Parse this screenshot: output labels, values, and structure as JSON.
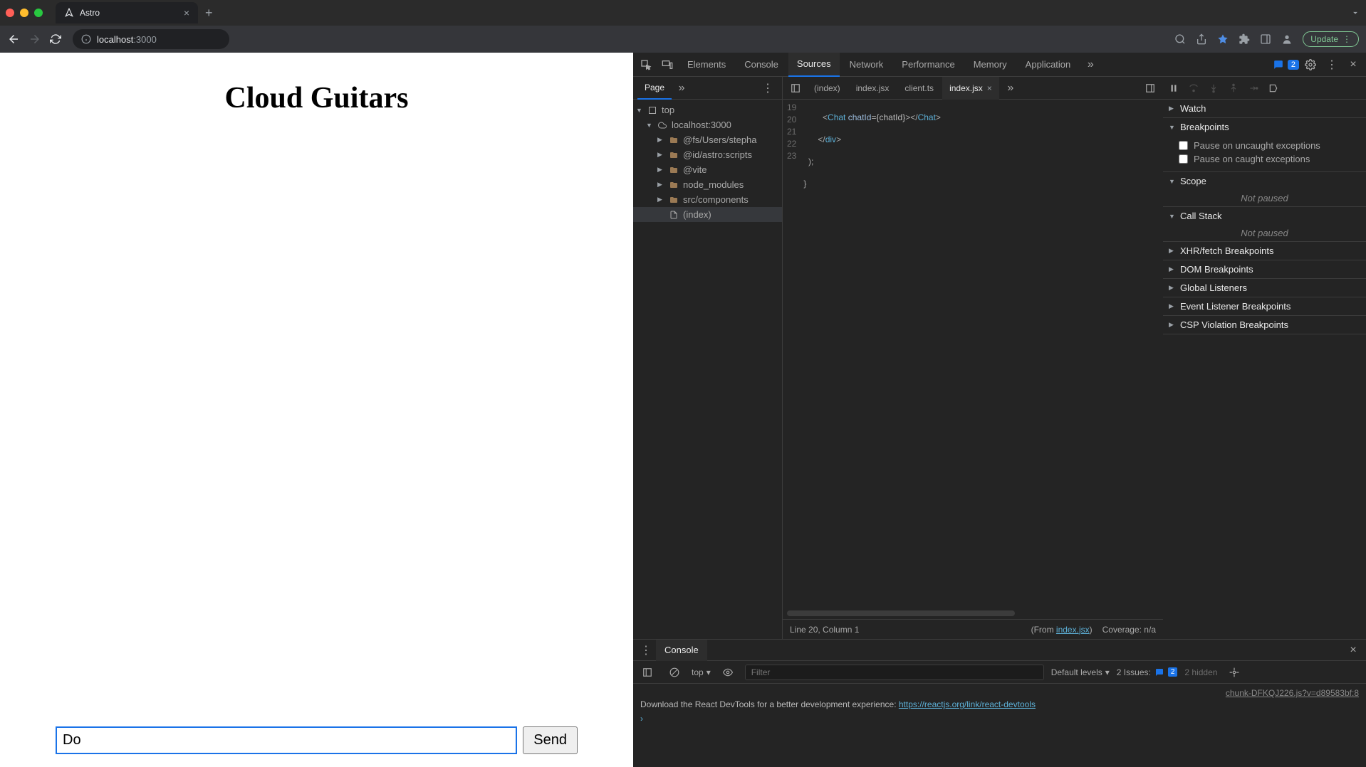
{
  "browser": {
    "tab_title": "Astro",
    "url_host": "localhost",
    "url_port": ":3000",
    "update_label": "Update"
  },
  "page": {
    "heading": "Cloud Guitars",
    "input_value": "Do",
    "send_label": "Send"
  },
  "devtools": {
    "tabs": [
      "Elements",
      "Console",
      "Sources",
      "Network",
      "Performance",
      "Memory",
      "Application"
    ],
    "active_tab": "Sources",
    "issues_count": "2",
    "file_nav_tab": "Page",
    "tree": {
      "top": "top",
      "host": "localhost:3000",
      "folders": [
        "@fs/Users/stepha",
        "@id/astro:scripts",
        "@vite",
        "node_modules",
        "src/components"
      ],
      "file": "(index)"
    },
    "editor_tabs": [
      "(index)",
      "index.jsx",
      "client.ts",
      "index.jsx"
    ],
    "active_editor_tab": 3,
    "code_lines": {
      "19": "        <Chat chatId={chatId}></Chat>",
      "20": "      </div>",
      "21": "  );",
      "22": "}",
      "23": ""
    },
    "status_line": "Line 20, Column 1",
    "status_from_prefix": "(From ",
    "status_from_file": "index.jsx",
    "status_from_suffix": ")",
    "status_coverage": "Coverage: n/a",
    "debug": {
      "watch": "Watch",
      "breakpoints": "Breakpoints",
      "pause_uncaught": "Pause on uncaught exceptions",
      "pause_caught": "Pause on caught exceptions",
      "scope": "Scope",
      "not_paused": "Not paused",
      "call_stack": "Call Stack",
      "xhr": "XHR/fetch Breakpoints",
      "dom": "DOM Breakpoints",
      "global": "Global Listeners",
      "event": "Event Listener Breakpoints",
      "csp": "CSP Violation Breakpoints"
    }
  },
  "console": {
    "tab": "Console",
    "context": "top",
    "filter_placeholder": "Filter",
    "levels": "Default levels",
    "issues_label": "2 Issues:",
    "issues_badge": "2",
    "hidden": "2 hidden",
    "source_link": "chunk-DFKQJ226.js?v=d89583bf:8",
    "message_prefix": "Download the React DevTools for a better development experience: ",
    "message_link": "https://reactjs.org/link/react-devtools"
  }
}
